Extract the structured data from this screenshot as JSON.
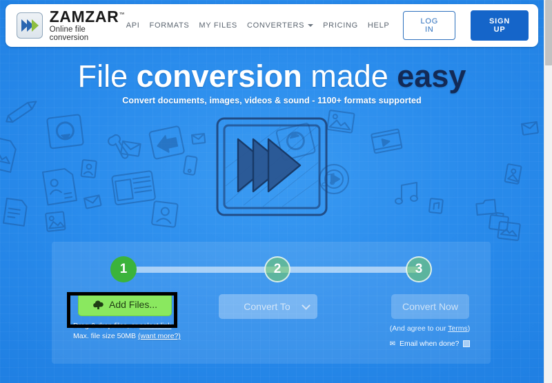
{
  "brand": {
    "name": "ZAMZAR",
    "tm": "™",
    "tagline": "Online file conversion",
    "logo_icon": "double-chevron-logo-icon"
  },
  "nav": {
    "links": [
      {
        "label": "API",
        "caret": false
      },
      {
        "label": "FORMATS",
        "caret": false
      },
      {
        "label": "MY FILES",
        "caret": false
      },
      {
        "label": "CONVERTERS",
        "caret": true
      },
      {
        "label": "PRICING",
        "caret": false
      },
      {
        "label": "HELP",
        "caret": false
      }
    ],
    "login_label": "LOG IN",
    "signup_label": "SIGN UP"
  },
  "hero": {
    "headline_part1": "File ",
    "headline_part2": "conversion",
    "headline_part3": " made ",
    "headline_part4": "easy",
    "subline": "Convert documents, images, videos & sound - 1100+ formats supported",
    "art_icon": "zamzar-sketch-logo-icon"
  },
  "widget": {
    "steps": [
      {
        "number": "1",
        "state": "active"
      },
      {
        "number": "2",
        "state": "inactive"
      },
      {
        "number": "3",
        "state": "inactive"
      }
    ],
    "step1": {
      "button_label": "Add Files...",
      "button_icon": "cloud-upload-icon",
      "helper_line1_pre": "Drag & drop files, or ",
      "helper_line1_link": "select link",
      "helper_line2_pre": "Max. file size 50MB ",
      "helper_line2_link": "(want more?)"
    },
    "step2": {
      "select_label": "Convert To",
      "caret_icon": "chevron-down-icon"
    },
    "step3": {
      "button_label": "Convert Now",
      "terms_pre": "(And agree to our ",
      "terms_link": "Terms",
      "terms_post": ")",
      "email_icon": "envelope-icon",
      "email_label": "Email when done?",
      "email_checked": false
    }
  },
  "colors": {
    "brand_blue": "#1f86e8",
    "signup_blue": "#1565c9",
    "step_green": "#3bb33b",
    "add_green": "#8ae85f",
    "headline_dark": "#132a56",
    "highlight_box": "#000000"
  },
  "scrollbar": {
    "thumb_position": "top"
  }
}
